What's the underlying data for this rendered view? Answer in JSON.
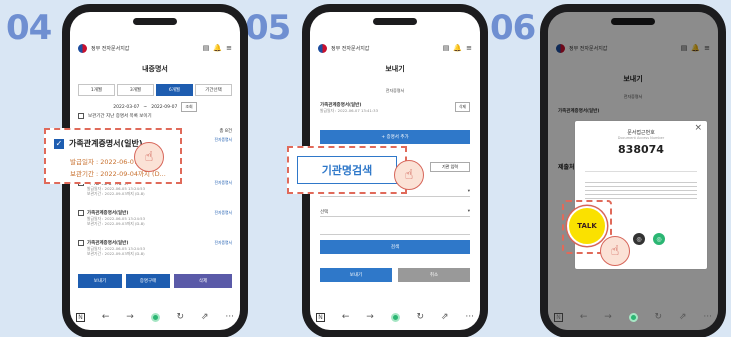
{
  "steps": [
    "04",
    "05",
    "06"
  ],
  "app": {
    "brand": "정부 전자문서지갑",
    "icons": [
      "wallet-icon",
      "bell-icon",
      "menu-icon"
    ]
  },
  "screen4": {
    "title": "내증명서",
    "tabs": [
      "1개월",
      "3개월",
      "6개월",
      "기간선택"
    ],
    "date_from": "2022-03-07",
    "date_to": "2022-09-07",
    "search_btn": "조회",
    "expired_note": "보관기간 지난 증명서 목록 보이기",
    "count": "총 8건",
    "items": [
      {
        "title": "가족관계증명서(일반)",
        "tag": "전자증명서",
        "issued": "발급일자 : 2022-06-07 13:...",
        "kept": "보관기간 : 2022-09-04까지 (D..."
      },
      {
        "title": "가족관계증명서(상세)",
        "tag": "전자증명서",
        "issued": "발급일자 : 2022-06-05 13:24:53",
        "kept": "보관기간 : 2022-09-03까지 (D-8)"
      },
      {
        "title": "가족관계증명서(일반)",
        "tag": "전자증명서",
        "issued": "발급일자 : 2022-06-05 13:24:53",
        "kept": "보관기간 : 2022-09-03까지 (D-8)"
      },
      {
        "title": "가족관계증명서(일반)",
        "tag": "전자증명서",
        "issued": "발급일자 : 2022-06-05 13:24:53",
        "kept": "보관기간 : 2022-09-03까지 (D-8)"
      }
    ],
    "callout": {
      "title": "가족관계증명서(일반)",
      "issued": "발급일자 : 2022-06-07 13:...",
      "kept": "보관기간 : 2022-09-04까지 (D..."
    },
    "buttons": {
      "send": "보내기",
      "request": "증명구매",
      "delete": "삭제"
    }
  },
  "screen5": {
    "title": "보내기",
    "section": "전자증명서",
    "doc_name": "가족관계증명서(일반)",
    "doc_issued": "발급일자 : 2022-06-07 13:41:33",
    "doc_action": "삭제",
    "add_btn": "+ 증명서 추가",
    "callout_label": "기관명검색",
    "search_tab_right": "기관 입력",
    "select_placeholder": "선택",
    "search_btn": "검색",
    "send_btn": "보내기",
    "cancel_btn": "취소"
  },
  "screen6": {
    "title": "보내기",
    "section": "전자증명서",
    "doc_name": "가족관계증명서(일반)",
    "side_label": "제출처",
    "modal_title": "문서접근번호",
    "modal_sub": "Document Access Number",
    "code": "838074",
    "talk": "TALK",
    "close": "×"
  },
  "colors": {
    "step": "#6f8fd1",
    "primary": "#1e5db0",
    "danger": "#5a5aa8",
    "callout": "#e06a5a",
    "kakao": "#fae100"
  }
}
